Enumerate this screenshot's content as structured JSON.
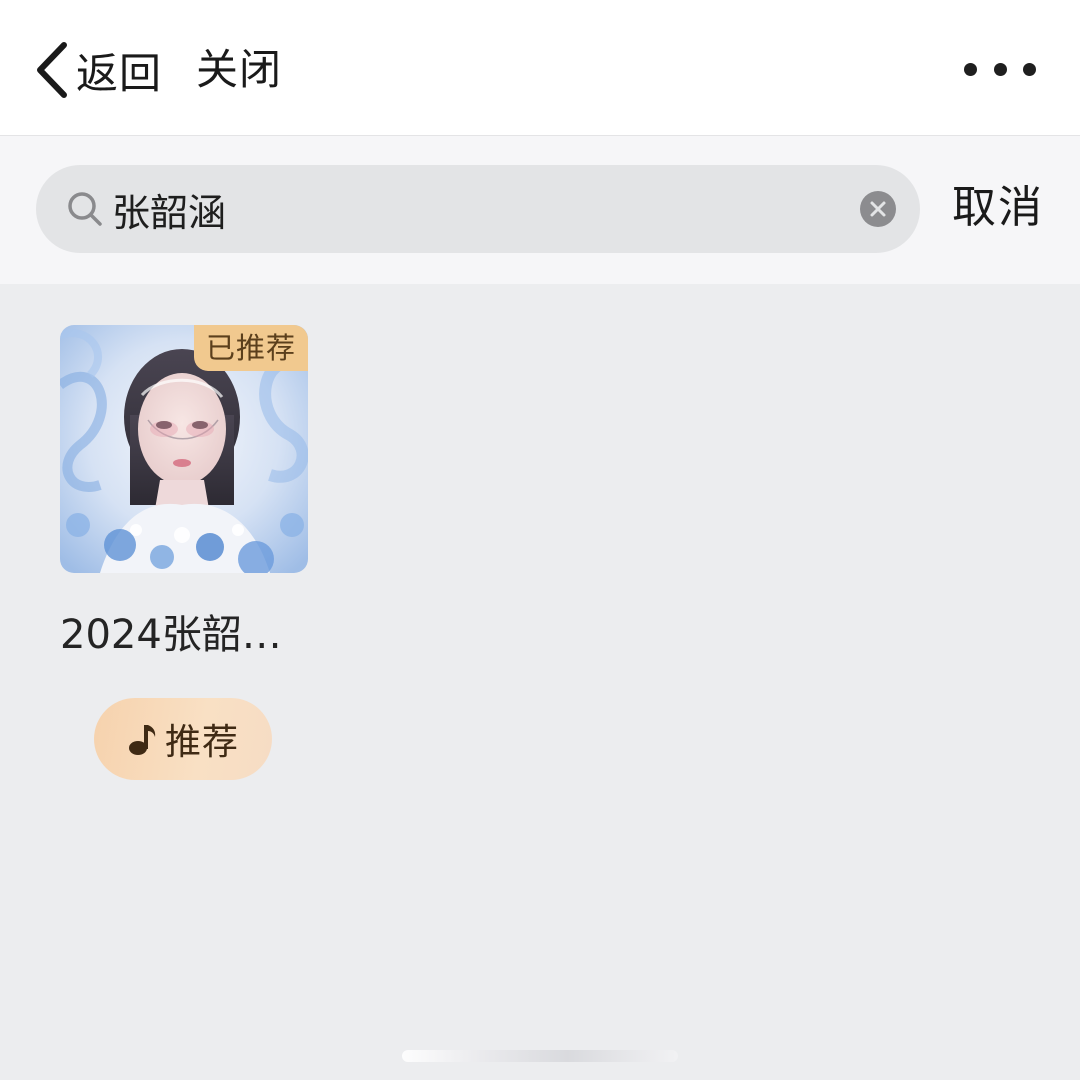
{
  "nav": {
    "back_label": "返回",
    "close_label": "关闭",
    "more_icon": "more-horizontal-icon"
  },
  "search": {
    "query": "张韶涵",
    "cancel_label": "取消",
    "search_icon": "magnifier-icon",
    "clear_icon": "clear-circle-icon"
  },
  "results": [
    {
      "title": "2024张韶…",
      "badge": "已推荐",
      "button_label": "推荐",
      "button_icon": "music-note-icon"
    }
  ],
  "colors": {
    "badge_bg": "#f1c98f",
    "button_bg": "#f7d9b8",
    "page_bg": "#ecedef"
  }
}
